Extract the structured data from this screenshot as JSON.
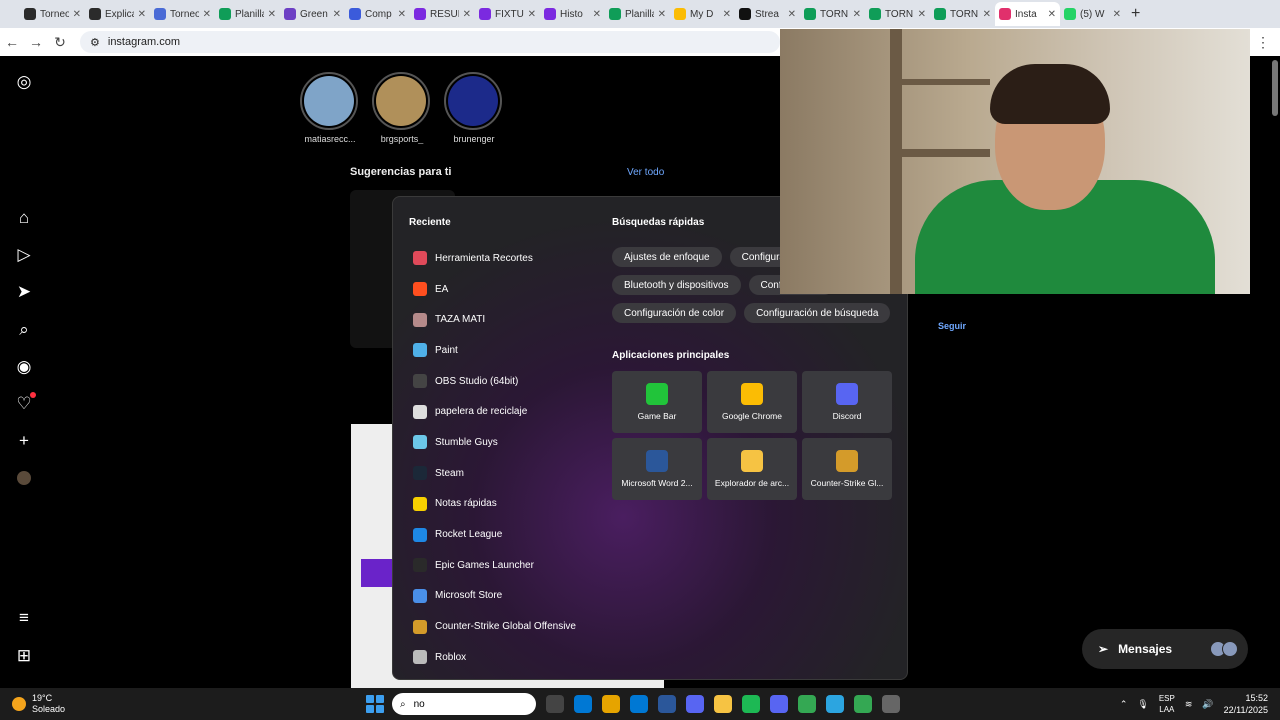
{
  "browser": {
    "tabs": [
      {
        "label": "Torneo",
        "color": "#2b2b2b"
      },
      {
        "label": "Explica",
        "color": "#2b2b2b"
      },
      {
        "label": "Torneo",
        "color": "#4a6bd6"
      },
      {
        "label": "Planilla",
        "color": "#0f9d58"
      },
      {
        "label": "Green",
        "color": "#6c3fc4"
      },
      {
        "label": "Comp",
        "color": "#3b5bdb"
      },
      {
        "label": "RESUL",
        "color": "#7b2ae0"
      },
      {
        "label": "FIXTU",
        "color": "#7b2ae0"
      },
      {
        "label": "Histo",
        "color": "#7b2ae0"
      },
      {
        "label": "Planilla",
        "color": "#0f9d58"
      },
      {
        "label": "My D",
        "color": "#fbbc04"
      },
      {
        "label": "Strea",
        "color": "#111111"
      },
      {
        "label": "TORN",
        "color": "#0f9d58"
      },
      {
        "label": "TORN",
        "color": "#0f9d58"
      },
      {
        "label": "TORN",
        "color": "#0f9d58"
      },
      {
        "label": "Insta",
        "color": "#e1306c",
        "active": true
      },
      {
        "label": "(5) W",
        "color": "#25d366"
      }
    ],
    "url": "instagram.com"
  },
  "instagram": {
    "stories": [
      {
        "name": "matiasrecc...",
        "color": "#7fa4c8"
      },
      {
        "name": "brgsports_",
        "color": "#b0905a"
      },
      {
        "name": "brunenger",
        "color": "#1c2a8a"
      }
    ],
    "suggestions_title": "Sugerencias para ti",
    "see_all": "Ver todo",
    "follow": "Seguir",
    "messages": "Mensajes"
  },
  "start_menu": {
    "recent_title": "Reciente",
    "recent": [
      {
        "label": "Herramienta Recortes",
        "color": "#e04a5a"
      },
      {
        "label": "EA",
        "color": "#ff4f1f"
      },
      {
        "label": "TAZA MATI",
        "color": "#b58a8a"
      },
      {
        "label": "Paint",
        "color": "#4fb0e8"
      },
      {
        "label": "OBS Studio (64bit)",
        "color": "#444444"
      },
      {
        "label": "papelera de reciclaje",
        "color": "#dddddd"
      },
      {
        "label": "Stumble Guys",
        "color": "#6cc7e8"
      },
      {
        "label": "Steam",
        "color": "#1b2838"
      },
      {
        "label": "Notas rápidas",
        "color": "#f7d000"
      },
      {
        "label": "Rocket League",
        "color": "#1e88e5"
      },
      {
        "label": "Epic Games Launcher",
        "color": "#2a2a2a"
      },
      {
        "label": "Microsoft Store",
        "color": "#4a8fe8"
      },
      {
        "label": "Counter-Strike Global Offensive",
        "color": "#d49b2a"
      },
      {
        "label": "Roblox",
        "color": "#bbbbbb"
      }
    ],
    "quick_title": "Búsquedas rápidas",
    "quick_rows": [
      [
        "Ajustes de enfoque",
        "Configuración"
      ],
      [
        "Bluetooth y dispositivos",
        "Configuración"
      ],
      [
        "Configuración de color",
        "Configuración de búsqueda"
      ]
    ],
    "apps_title": "Aplicaciones principales",
    "apps": [
      {
        "label": "Game Bar",
        "color": "#21c43a"
      },
      {
        "label": "Google Chrome",
        "color": "#fbbc04"
      },
      {
        "label": "Discord",
        "color": "#5865f2"
      },
      {
        "label": "Microsoft Word 2...",
        "color": "#2b579a"
      },
      {
        "label": "Explorador de arc...",
        "color": "#f6c343"
      },
      {
        "label": "Counter-Strike Gl...",
        "color": "#d49b2a"
      }
    ]
  },
  "taskbar": {
    "temperature": "19°C",
    "weather": "Soleado",
    "search_value": "no",
    "icons": [
      "#444444",
      "#0078d4",
      "#e6a400",
      "#0078d4",
      "#2b579a",
      "#5865f2",
      "#f6c343",
      "#1db954",
      "#5865f2",
      "#34a853",
      "#2ca5e0",
      "#34a853",
      "#666666"
    ],
    "lang_top": "ESP",
    "lang_bottom": "LAA",
    "time": "15:52",
    "date": "22/11/2025"
  }
}
